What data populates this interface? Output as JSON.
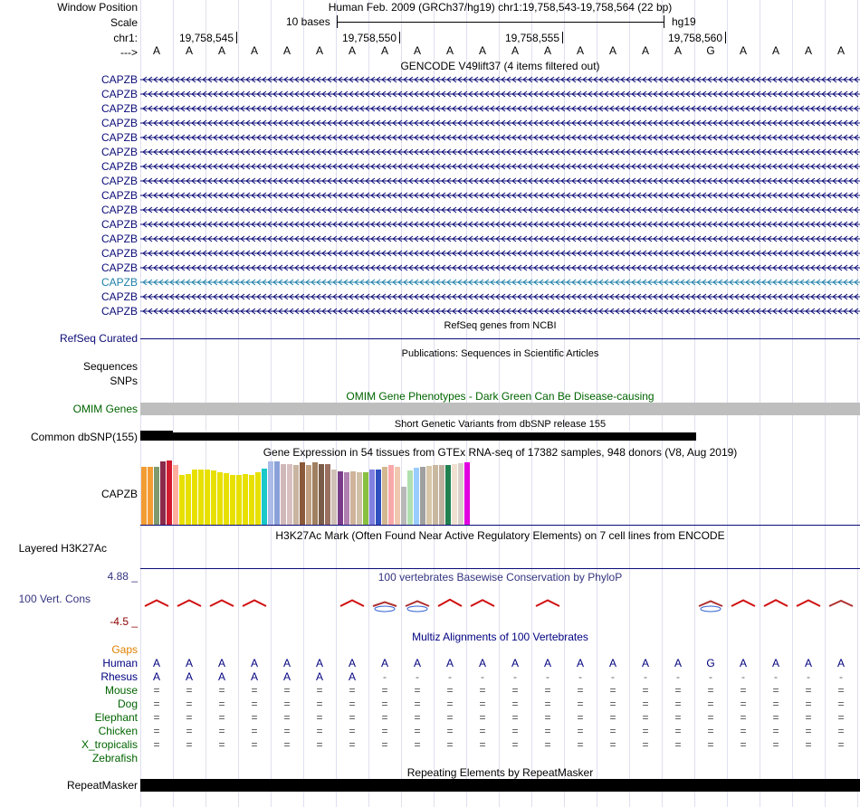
{
  "labels": {
    "window_position": "Window Position",
    "scale": "Scale",
    "chrom": "chr1:",
    "strand": "--->",
    "refseq": "RefSeq Curated",
    "sequences": "Sequences",
    "snps": "SNPs",
    "omim": "OMIM Genes",
    "dbsnp": "Common dbSNP(155)",
    "gtex": "CAPZB",
    "h3k27ac": "Layered H3K27Ac",
    "cons": "100 Vert. Cons",
    "cons_max": "4.88 _",
    "cons_min": "-4.5 _",
    "gaps": "Gaps",
    "repeatmasker": "RepeatMasker"
  },
  "header": {
    "assembly": "Human Feb. 2009 (GRCh37/hg19)   chr1:19,758,543-19,758,564 (22 bp)",
    "scale_text": "10 bases",
    "scale_db": "hg19",
    "positions": [
      "19,758,545",
      "19,758,550",
      "19,758,555",
      "19,758,560"
    ]
  },
  "sequence": [
    "A",
    "A",
    "A",
    "A",
    "A",
    "A",
    "A",
    "A",
    "A",
    "A",
    "A",
    "A",
    "A",
    "A",
    "A",
    "A",
    "A",
    "G",
    "A",
    "A",
    "A",
    "A"
  ],
  "gencode": {
    "title": "GENCODE V49lift37 (4 items filtered out)",
    "items": [
      "CAPZB",
      "CAPZB",
      "CAPZB",
      "CAPZB",
      "CAPZB",
      "CAPZB",
      "CAPZB",
      "CAPZB",
      "CAPZB",
      "CAPZB",
      "CAPZB",
      "CAPZB",
      "CAPZB",
      "CAPZB",
      "CAPZB",
      "CAPZB",
      "CAPZB"
    ],
    "highlight_index": 14,
    "colors": {
      "normal": "#0c0c78",
      "highlight": "#1e7fa8"
    }
  },
  "tracks": {
    "refseq_title": "RefSeq genes from NCBI",
    "pubs_title": "Publications: Sequences in Scientific Articles",
    "omim_title": "OMIM Gene Phenotypes - Dark Green Can Be Disease-causing",
    "dbsnp_title": "Short Genetic Variants from dbSNP release 155",
    "gtex_title": "Gene Expression in 54 tissues from GTEx RNA-seq of 17382 samples, 948 donors (V8, Aug 2019)",
    "h3k27ac_title": "H3K27Ac Mark (Often Found Near Active Regulatory Elements) on 7 cell lines from ENCODE",
    "cons_title": "100 vertebrates Basewise Conservation by PhyloP",
    "multiz_title": "Multiz Alignments of 100 Vertebrates",
    "repeat_title": "Repeating Elements by RepeatMasker"
  },
  "gtex_colors": [
    "#f39c33",
    "#f39c33",
    "#7f9a6e",
    "#8b2a4a",
    "#d21b2e",
    "#ffae9e",
    "#e8e000",
    "#e8e000",
    "#e8e000",
    "#e8e000",
    "#e8e000",
    "#e8e000",
    "#e8e000",
    "#e8e000",
    "#e8e000",
    "#e8e000",
    "#e8e000",
    "#e8e000",
    "#e8e000",
    "#19c8c8",
    "#aabbe8",
    "#8aa0d8",
    "#d0b8b8",
    "#d8c0c0",
    "#c8b4a0",
    "#8b5a3a",
    "#c0a080",
    "#a08060",
    "#7a5c48",
    "#9a7060",
    "#d0c0b8",
    "#7a3c8a",
    "#b080b0",
    "#cfb39a",
    "#d0c0a8",
    "#88c040",
    "#8080e0",
    "#3050c0",
    "#d2b890",
    "#f8a8a8",
    "#f0c8b0",
    "#b8b8b8",
    "#b0e0b0",
    "#99ccff",
    "#a0a0a0",
    "#d8c8a8",
    "#c8b8a0",
    "#c0b0a0",
    "#208050",
    "#f0e0d0",
    "#d8d0c8",
    "#e000e0"
  ],
  "gtex_values": [
    64,
    64,
    64,
    70,
    71,
    66,
    55,
    56,
    61,
    61,
    61,
    60,
    58,
    57,
    55,
    55,
    56,
    55,
    58,
    62,
    70,
    70,
    67,
    67,
    66,
    69,
    66,
    69,
    67,
    67,
    61,
    59,
    58,
    59,
    58,
    58,
    61,
    61,
    64,
    66,
    64,
    42,
    60,
    63,
    64,
    65,
    66,
    66,
    66,
    67,
    68,
    69
  ],
  "conservation_peaks": [
    0.7,
    0.7,
    0.7,
    0.7,
    0,
    0,
    0.7,
    0.3,
    0.5,
    0.85,
    0.75,
    0,
    0.7,
    0,
    0,
    0,
    0,
    0.5,
    0.7,
    0.75,
    0.7,
    0.6
  ],
  "multiz": {
    "species": [
      "Human",
      "Rhesus",
      "Mouse",
      "Dog",
      "Elephant",
      "Chicken",
      "X_tropicalis",
      "Zebrafish"
    ],
    "colors": [
      "#000080",
      "#000080",
      "#006400",
      "#006400",
      "#006400",
      "#006400",
      "#006400",
      "#006400"
    ],
    "rhesus": [
      "A",
      "A",
      "A",
      "A",
      "A",
      "A",
      "A",
      "-",
      "-",
      "-",
      "-",
      "-",
      "-",
      "-",
      "-",
      "-",
      "-",
      "-",
      "-",
      "-",
      "-",
      "-"
    ],
    "double_line_rows": [
      "Mouse",
      "Dog",
      "Elephant",
      "Chicken",
      "X_tropicalis"
    ]
  }
}
